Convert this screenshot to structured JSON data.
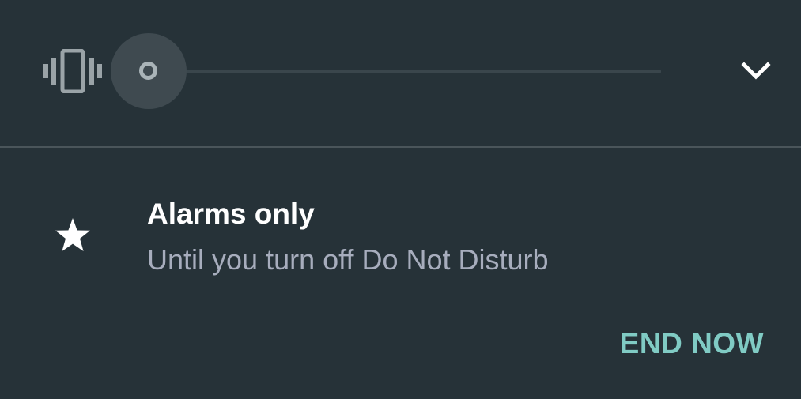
{
  "volume": {
    "mode_icon": "vibrate-icon",
    "level": 0,
    "expand_icon": "chevron-down-icon"
  },
  "dnd": {
    "icon": "star-icon",
    "title": "Alarms only",
    "subtitle": "Until you turn off Do Not Disturb",
    "end_label": "END NOW"
  },
  "colors": {
    "background": "#263238",
    "accent": "#80cbc4",
    "secondary_text": "#a7adbd"
  }
}
